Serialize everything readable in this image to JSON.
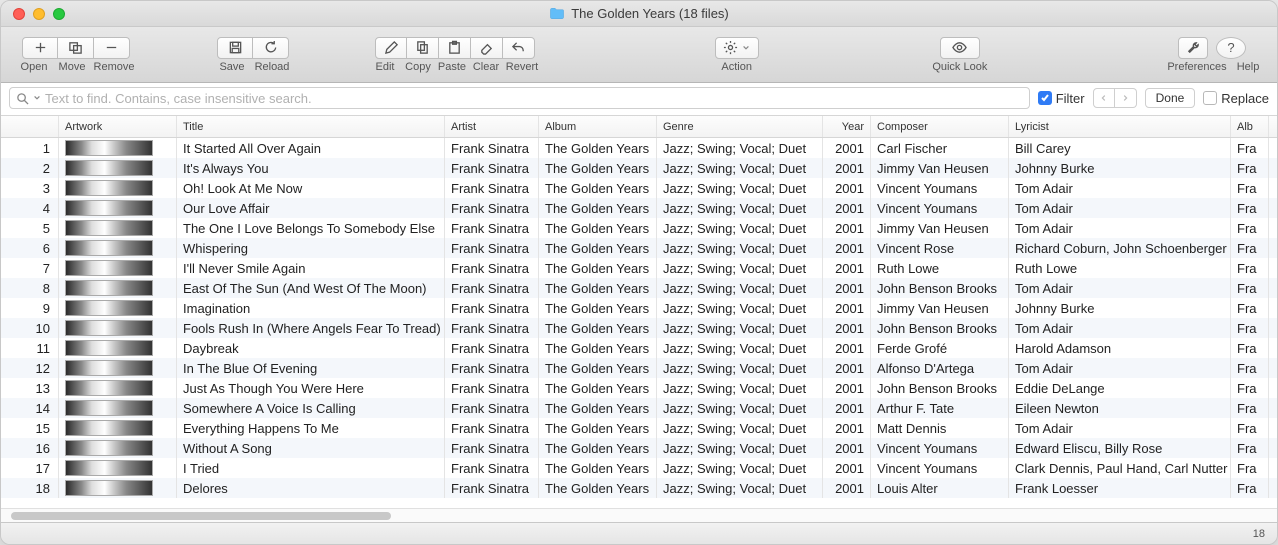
{
  "window": {
    "title": "The Golden Years (18 files)"
  },
  "toolbar": {
    "open": "Open",
    "move": "Move",
    "remove": "Remove",
    "save": "Save",
    "reload": "Reload",
    "edit": "Edit",
    "copy": "Copy",
    "paste": "Paste",
    "clear": "Clear",
    "revert": "Revert",
    "action": "Action",
    "quicklook": "Quick Look",
    "preferences": "Preferences",
    "help": "Help"
  },
  "search": {
    "placeholder": "Text to find. Contains, case insensitive search."
  },
  "filter": {
    "label": "Filter",
    "checked": true
  },
  "done": "Done",
  "replace": {
    "label": "Replace",
    "checked": false
  },
  "columns": {
    "artwork": "Artwork",
    "title": "Title",
    "artist": "Artist",
    "album": "Album",
    "genre": "Genre",
    "year": "Year",
    "composer": "Composer",
    "lyricist": "Lyricist",
    "albart": "Alb"
  },
  "rows": [
    {
      "n": 1,
      "title": "It Started All Over Again",
      "artist": "Frank Sinatra",
      "album": "The Golden Years",
      "genre": "Jazz; Swing; Vocal; Duet",
      "year": 2001,
      "composer": "Carl Fischer",
      "lyricist": "Bill Carey",
      "albart": "Fra"
    },
    {
      "n": 2,
      "title": "It's Always You",
      "artist": "Frank Sinatra",
      "album": "The Golden Years",
      "genre": "Jazz; Swing; Vocal; Duet",
      "year": 2001,
      "composer": "Jimmy Van Heusen",
      "lyricist": "Johnny Burke",
      "albart": "Fra"
    },
    {
      "n": 3,
      "title": "Oh! Look At Me Now",
      "artist": "Frank Sinatra",
      "album": "The Golden Years",
      "genre": "Jazz; Swing; Vocal; Duet",
      "year": 2001,
      "composer": "Vincent Youmans",
      "lyricist": "Tom Adair",
      "albart": "Fra"
    },
    {
      "n": 4,
      "title": "Our Love Affair",
      "artist": "Frank Sinatra",
      "album": "The Golden Years",
      "genre": "Jazz; Swing; Vocal; Duet",
      "year": 2001,
      "composer": "Vincent Youmans",
      "lyricist": "Tom Adair",
      "albart": "Fra"
    },
    {
      "n": 5,
      "title": "The One I Love Belongs To Somebody Else",
      "artist": "Frank Sinatra",
      "album": "The Golden Years",
      "genre": "Jazz; Swing; Vocal; Duet",
      "year": 2001,
      "composer": "Jimmy Van Heusen",
      "lyricist": "Tom Adair",
      "albart": "Fra"
    },
    {
      "n": 6,
      "title": "Whispering",
      "artist": "Frank Sinatra",
      "album": "The Golden Years",
      "genre": "Jazz; Swing; Vocal; Duet",
      "year": 2001,
      "composer": "Vincent Rose",
      "lyricist": "Richard Coburn, John Schoenberger",
      "albart": "Fra"
    },
    {
      "n": 7,
      "title": "I'll Never Smile Again",
      "artist": "Frank Sinatra",
      "album": "The Golden Years",
      "genre": "Jazz; Swing; Vocal; Duet",
      "year": 2001,
      "composer": "Ruth Lowe",
      "lyricist": "Ruth Lowe",
      "albart": "Fra"
    },
    {
      "n": 8,
      "title": "East Of The Sun (And West Of The Moon)",
      "artist": "Frank Sinatra",
      "album": "The Golden Years",
      "genre": "Jazz; Swing; Vocal; Duet",
      "year": 2001,
      "composer": "John Benson Brooks",
      "lyricist": "Tom Adair",
      "albart": "Fra"
    },
    {
      "n": 9,
      "title": "Imagination",
      "artist": "Frank Sinatra",
      "album": "The Golden Years",
      "genre": "Jazz; Swing; Vocal; Duet",
      "year": 2001,
      "composer": "Jimmy Van Heusen",
      "lyricist": "Johnny Burke",
      "albart": "Fra"
    },
    {
      "n": 10,
      "title": "Fools Rush In (Where Angels Fear To Tread)",
      "artist": "Frank Sinatra",
      "album": "The Golden Years",
      "genre": "Jazz; Swing; Vocal; Duet",
      "year": 2001,
      "composer": "John Benson Brooks",
      "lyricist": "Tom Adair",
      "albart": "Fra"
    },
    {
      "n": 11,
      "title": "Daybreak",
      "artist": "Frank Sinatra",
      "album": "The Golden Years",
      "genre": "Jazz; Swing; Vocal; Duet",
      "year": 2001,
      "composer": "Ferde Grofé",
      "lyricist": "Harold Adamson",
      "albart": "Fra"
    },
    {
      "n": 12,
      "title": "In The Blue Of Evening",
      "artist": "Frank Sinatra",
      "album": "The Golden Years",
      "genre": "Jazz; Swing; Vocal; Duet",
      "year": 2001,
      "composer": "Alfonso D'Artega",
      "lyricist": "Tom Adair",
      "albart": "Fra"
    },
    {
      "n": 13,
      "title": "Just As Though You Were Here",
      "artist": "Frank Sinatra",
      "album": "The Golden Years",
      "genre": "Jazz; Swing; Vocal; Duet",
      "year": 2001,
      "composer": "John Benson Brooks",
      "lyricist": "Eddie DeLange",
      "albart": "Fra"
    },
    {
      "n": 14,
      "title": "Somewhere A Voice Is Calling",
      "artist": "Frank Sinatra",
      "album": "The Golden Years",
      "genre": "Jazz; Swing; Vocal; Duet",
      "year": 2001,
      "composer": "Arthur F. Tate",
      "lyricist": "Eileen Newton",
      "albart": "Fra"
    },
    {
      "n": 15,
      "title": "Everything Happens To Me",
      "artist": "Frank Sinatra",
      "album": "The Golden Years",
      "genre": "Jazz; Swing; Vocal; Duet",
      "year": 2001,
      "composer": "Matt Dennis",
      "lyricist": "Tom Adair",
      "albart": "Fra"
    },
    {
      "n": 16,
      "title": "Without A Song",
      "artist": "Frank Sinatra",
      "album": "The Golden Years",
      "genre": "Jazz; Swing; Vocal; Duet",
      "year": 2001,
      "composer": "Vincent Youmans",
      "lyricist": "Edward Eliscu, Billy Rose",
      "albart": "Fra"
    },
    {
      "n": 17,
      "title": "I Tried",
      "artist": "Frank Sinatra",
      "album": "The Golden Years",
      "genre": "Jazz; Swing; Vocal; Duet",
      "year": 2001,
      "composer": "Vincent Youmans",
      "lyricist": "Clark Dennis, Paul Hand, Carl Nutter",
      "albart": "Fra"
    },
    {
      "n": 18,
      "title": "Delores",
      "artist": "Frank Sinatra",
      "album": "The Golden Years",
      "genre": "Jazz; Swing; Vocal; Duet",
      "year": 2001,
      "composer": "Louis Alter",
      "lyricist": "Frank Loesser",
      "albart": "Fra"
    }
  ],
  "status": {
    "count": "18"
  }
}
